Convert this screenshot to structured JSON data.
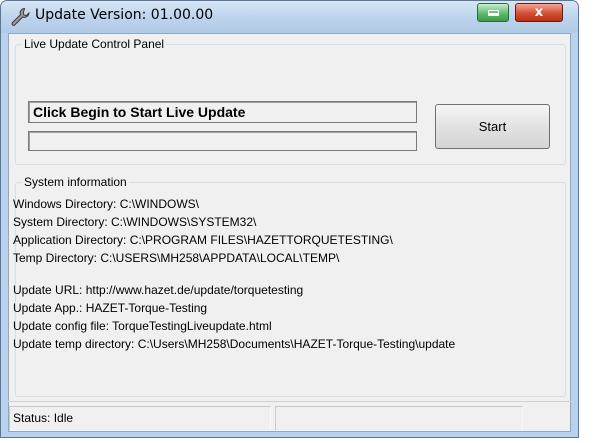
{
  "window": {
    "title": "Update Version: 01.00.00",
    "close_label": "x"
  },
  "live_update": {
    "group_title": "Live Update Control Panel",
    "message": "Click Begin to Start Live Update",
    "start_label": "Start",
    "progress": 0
  },
  "system_info": {
    "group_title": "System information",
    "lines": [
      "Windows Directory: C:\\WINDOWS\\",
      "System Directory: C:\\WINDOWS\\SYSTEM32\\",
      "Application Directory: C:\\PROGRAM FILES\\HAZETTORQUETESTING\\",
      "Temp Directory: C:\\USERS\\MH258\\APPDATA\\LOCAL\\TEMP\\"
    ],
    "update_lines": [
      "Update URL: http://www.hazet.de/update/torquetesting",
      "Update App.: HAZET-Torque-Testing",
      "Update config file: TorqueTestingLiveupdate.html",
      "Update temp directory: C:\\Users\\MH258\\Documents\\HAZET-Torque-Testing\\update"
    ]
  },
  "statusbar": {
    "status": "Status: Idle",
    "pane2": ""
  }
}
